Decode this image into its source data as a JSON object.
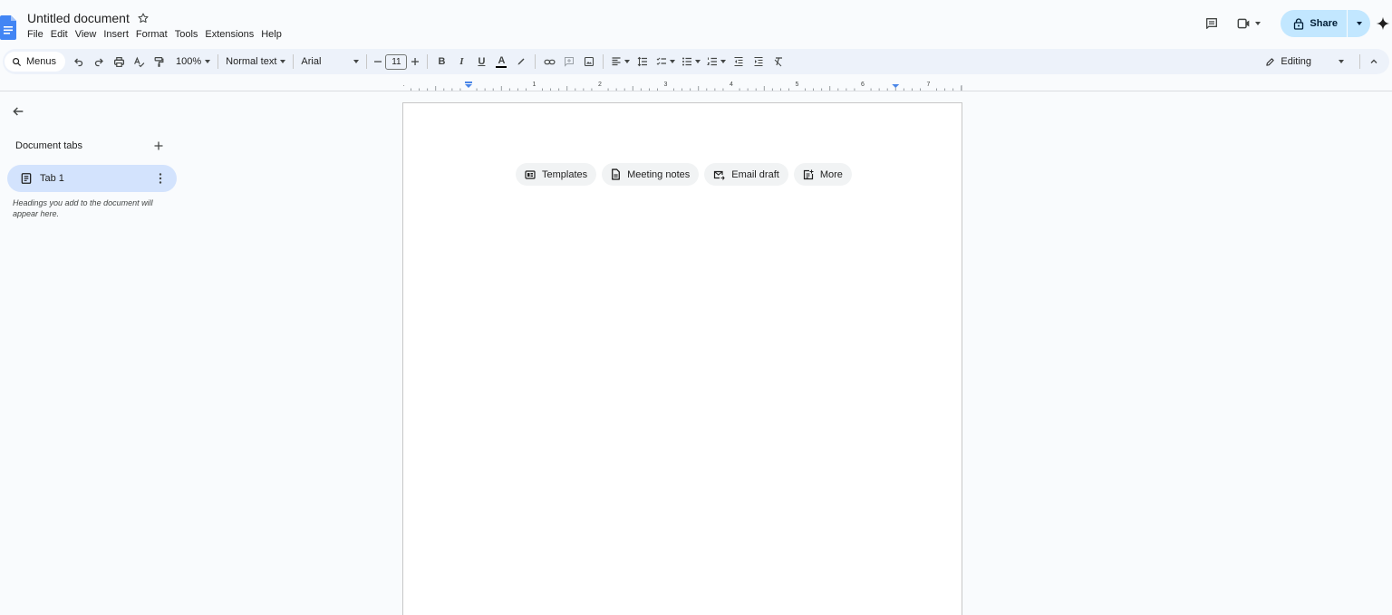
{
  "header": {
    "doc_title": "Untitled document",
    "menus": [
      "File",
      "Edit",
      "View",
      "Insert",
      "Format",
      "Tools",
      "Extensions",
      "Help"
    ],
    "share_label": "Share"
  },
  "toolbar": {
    "menus_label": "Menus",
    "zoom": "100%",
    "style": "Normal text",
    "font": "Arial",
    "font_size": "11",
    "bold": "B",
    "italic": "I",
    "underline": "U",
    "text_color": "A",
    "editing_label": "Editing"
  },
  "ruler": {
    "numbers": [
      "1",
      "1",
      "2",
      "3",
      "4",
      "5",
      "6",
      "7"
    ]
  },
  "sidebar": {
    "heading": "Document tabs",
    "tab_label": "Tab 1",
    "hint": "Headings you add to the document will appear here."
  },
  "chips": {
    "templates": "Templates",
    "meeting_notes": "Meeting notes",
    "email_draft": "Email draft",
    "more": "More"
  },
  "colors": {
    "background": "#f9fbfd",
    "toolbar": "#edf2fa",
    "share_button": "#c2e7ff",
    "active_tab": "#d3e3fd",
    "docs_blue": "#4285f4",
    "ruler_marker": "#4a86e8"
  },
  "icons": {
    "logo": "google-docs-logo",
    "star": "star-icon",
    "comments": "comments-icon",
    "meet": "video-call-icon",
    "lock": "lock-icon",
    "gemini": "gemini-spark-icon",
    "back": "arrow-back-icon"
  }
}
